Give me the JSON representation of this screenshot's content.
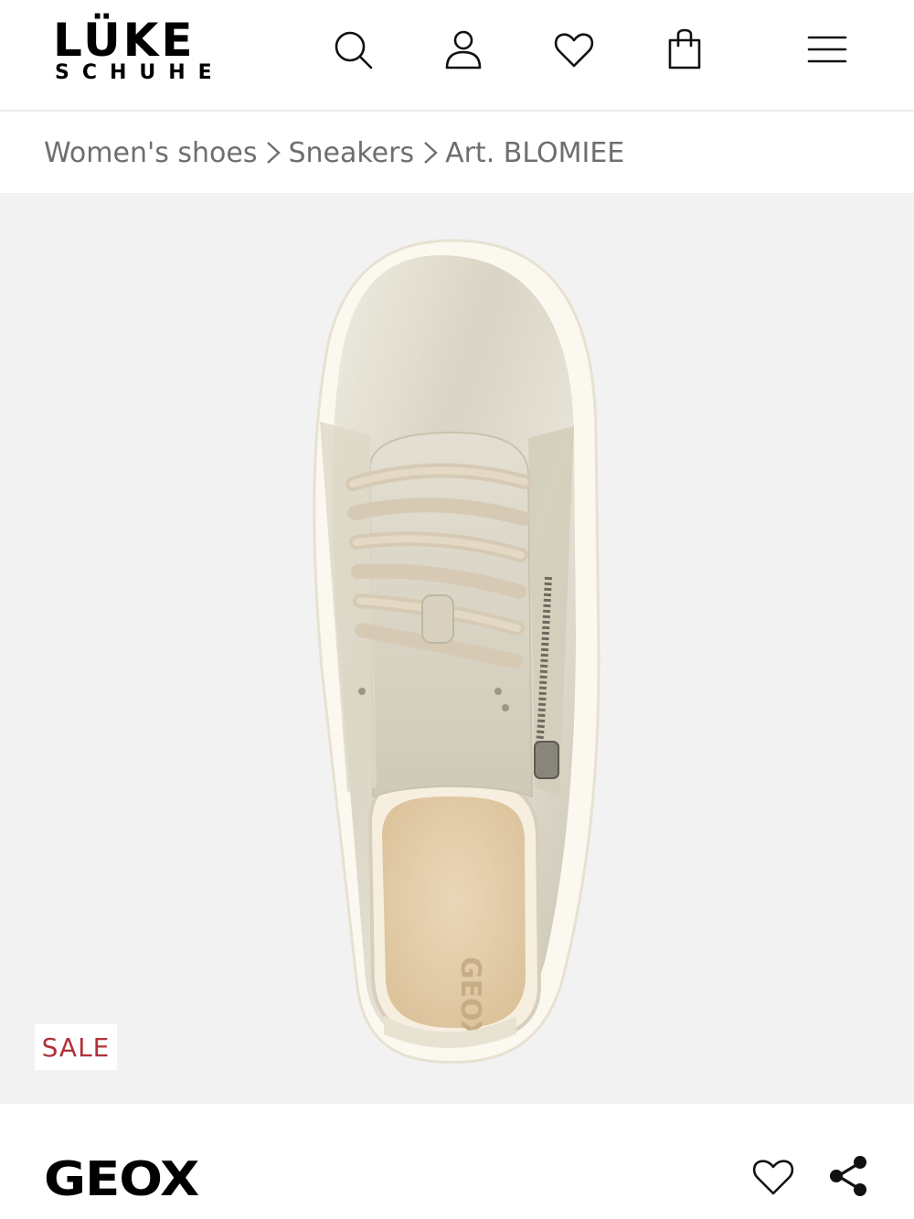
{
  "header": {
    "logo_line1": "LÜKE",
    "logo_line2": "SCHUHE",
    "icons": [
      "search-icon",
      "user-icon",
      "heart-icon",
      "shopping-bag-icon",
      "menu-icon"
    ]
  },
  "breadcrumb": {
    "items": [
      "Women's shoes",
      "Sneakers",
      "Art. BLOMIEE"
    ]
  },
  "product": {
    "badge": "SALE",
    "brand": "GEOX",
    "image_alt_text": "GEOX",
    "colors": {
      "background": "#f2f2f2",
      "sale": "#b0313a"
    }
  },
  "actions": {
    "icons": [
      "heart-icon",
      "share-icon"
    ]
  }
}
